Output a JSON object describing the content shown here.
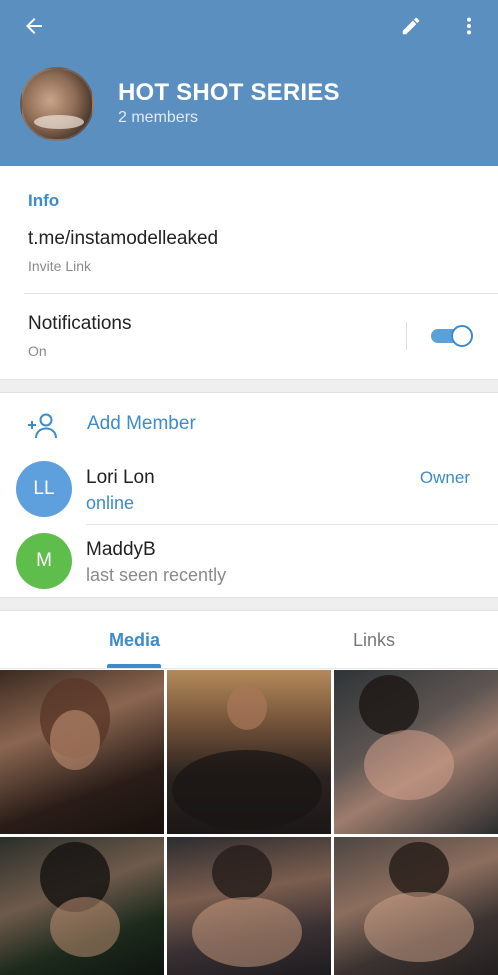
{
  "header": {
    "title": "HOT SHOT SERIES",
    "subtitle": "2 members",
    "icons": {
      "back": "arrow-left-icon",
      "edit": "pencil-icon",
      "more": "more-vertical-icon"
    },
    "color": "#5b8fbf"
  },
  "info": {
    "heading": "Info",
    "link": "t.me/instamodelleaked",
    "link_label": "Invite Link",
    "notifications_label": "Notifications",
    "notifications_state": "On",
    "notifications_enabled": true
  },
  "members": {
    "add_label": "Add Member",
    "list": [
      {
        "initials": "LL",
        "name": "Lori Lon",
        "status": "online",
        "role": "Owner",
        "avatar_color": "#5ea0de"
      },
      {
        "initials": "M",
        "name": "MaddyB",
        "status": "last seen recently",
        "role": "",
        "avatar_color": "#5fbe4b"
      }
    ]
  },
  "tabs": [
    {
      "label": "Media",
      "active": true
    },
    {
      "label": "Links",
      "active": false
    }
  ],
  "accent_color": "#3d8bc9"
}
